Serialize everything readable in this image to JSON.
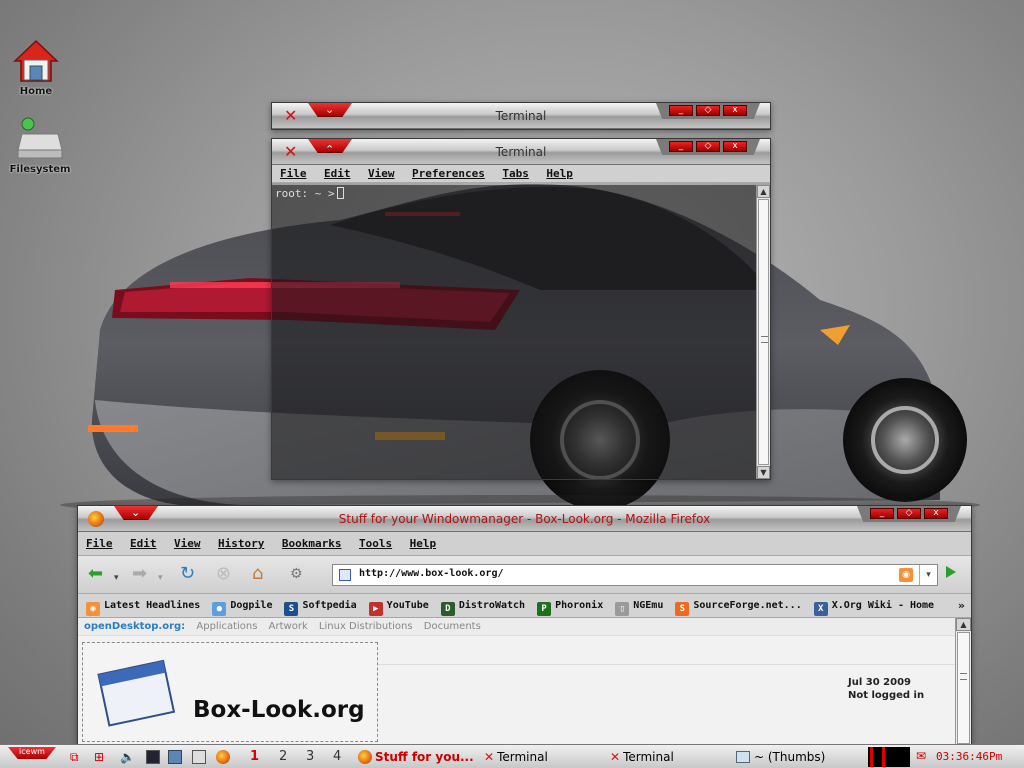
{
  "desktop": {
    "icons": [
      {
        "label": "Home"
      },
      {
        "label": "Filesystem"
      }
    ]
  },
  "terminal_back": {
    "title": "Terminal",
    "buttons": {
      "minimize": "_",
      "maximize": "◇",
      "close": "x"
    }
  },
  "terminal_front": {
    "title": "Terminal",
    "menu": [
      "File",
      "Edit",
      "View",
      "Preferences",
      "Tabs",
      "Help"
    ],
    "prompt": "root: ~ >",
    "buttons": {
      "minimize": "_",
      "maximize": "◇",
      "close": "x"
    }
  },
  "firefox": {
    "title": "Stuff for your Windowmanager - Box-Look.org - Mozilla Firefox",
    "menu": [
      "File",
      "Edit",
      "View",
      "History",
      "Bookmarks",
      "Tools",
      "Help"
    ],
    "url": "http://www.box-look.org/",
    "bookmarks": [
      {
        "label": "Latest Headlines",
        "icon": "rss-icon",
        "color": "#f4923a",
        "glyph": "◉"
      },
      {
        "label": "Dogpile",
        "icon": "dogpile-icon",
        "color": "#5aa0e0",
        "glyph": "●"
      },
      {
        "label": "Softpedia",
        "icon": "softpedia-icon",
        "color": "#1f4e8c",
        "glyph": "S"
      },
      {
        "label": "YouTube",
        "icon": "youtube-icon",
        "color": "#c4302b",
        "glyph": "▶"
      },
      {
        "label": "DistroWatch",
        "icon": "distrowatch-icon",
        "color": "#2b5d2b",
        "glyph": "D"
      },
      {
        "label": "Phoronix",
        "icon": "phoronix-icon",
        "color": "#1e6f1e",
        "glyph": "P"
      },
      {
        "label": "NGEmu",
        "icon": "page-icon",
        "color": "#9a9a9a",
        "glyph": "▯"
      },
      {
        "label": "SourceForge.net...",
        "icon": "sourceforge-icon",
        "color": "#ef6a1f",
        "glyph": "S"
      },
      {
        "label": "X.Org Wiki - Home",
        "icon": "xorg-icon",
        "color": "#3a5f9b",
        "glyph": "X"
      }
    ],
    "bookmarks_more": "»",
    "page": {
      "od_brand": "openDesktop.org:",
      "od_links": [
        "Applications",
        "Artwork",
        "Linux Distributions",
        "Documents"
      ],
      "site_title": "Box-Look.org",
      "date": "Jul 30 2009",
      "status": "Not logged in"
    },
    "buttons": {
      "minimize": "_",
      "maximize": "◇",
      "close": "x"
    }
  },
  "taskbar": {
    "start_label": "icewm",
    "workspaces": [
      "1",
      "2",
      "3",
      "4"
    ],
    "tasks": [
      {
        "label": "Stuff for you...",
        "active": true
      },
      {
        "label": "Terminal",
        "active": false
      },
      {
        "label": "Terminal",
        "active": false
      },
      {
        "label": "~ (Thumbs)",
        "active": false
      }
    ],
    "clock": "03:36:46Pm"
  },
  "colors": {
    "accent_red": "#cc0000",
    "titlebar_grey": "#c9c9c9"
  }
}
